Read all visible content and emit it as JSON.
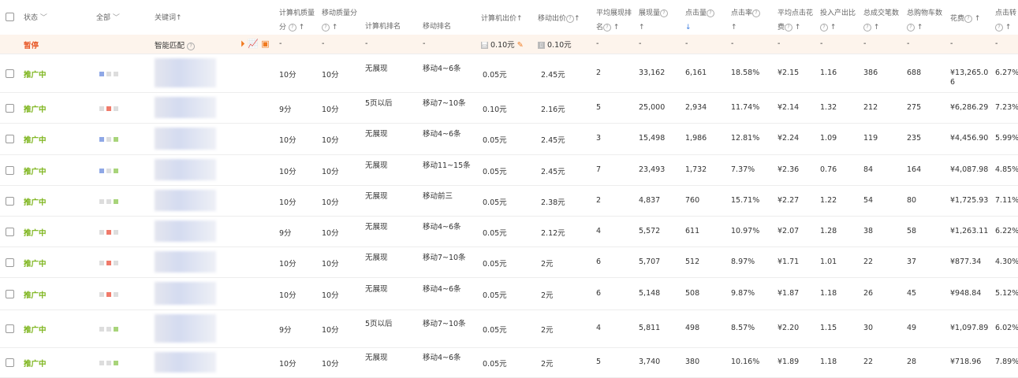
{
  "header": {
    "status": "状态",
    "all": "全部",
    "keyword": "关键词",
    "pc_quality_1": "计算机质量",
    "pc_quality_2": "分",
    "mobile_quality_1": "移动质量分",
    "pc_rank": "计算机排名",
    "mobile_rank": "移动排名",
    "pc_bid": "计算机出价",
    "mobile_bid": "移动出价",
    "avg_rank_1": "平均展现排",
    "avg_rank_2": "名",
    "impressions": "展现量",
    "clicks": "点击量",
    "ctr": "点击率",
    "avg_cpc_1": "平均点击花",
    "avg_cpc_2": "费",
    "roi": "投入产出比",
    "orders": "总成交笔数",
    "carts": "总购物车数",
    "cost": "花费",
    "conv": "点击转"
  },
  "paused_row": {
    "status": "暂停",
    "keyword": "智能匹配",
    "pc_bid": "0.10元",
    "mobile_bid": "0.10元",
    "dash": "-"
  },
  "rows": [
    {
      "status": "推广中",
      "sq": [
        "#8fa8e6",
        "#ddd",
        "#ddd"
      ],
      "pcq": "10分",
      "mq": "10分",
      "pcr": "无展现",
      "mr": "移动4~6条",
      "pcb": "0.05元",
      "mb": "2.45元",
      "avg": "2",
      "imp": "33,162",
      "clk": "6,161",
      "ctr": "18.58%",
      "cpc": "¥2.15",
      "roi": "1.16",
      "ord": "386",
      "cart": "688",
      "cost": "¥13,265.06",
      "conv": "6.27%"
    },
    {
      "status": "推广中",
      "sq": [
        "#ddd",
        "#f07a6a",
        "#ddd"
      ],
      "pcq": "9分",
      "mq": "10分",
      "pcr": "5页以后",
      "mr": "移动7~10条",
      "pcb": "0.10元",
      "mb": "2.16元",
      "avg": "5",
      "imp": "25,000",
      "clk": "2,934",
      "ctr": "11.74%",
      "cpc": "¥2.14",
      "roi": "1.32",
      "ord": "212",
      "cart": "275",
      "cost": "¥6,286.29",
      "conv": "7.23%"
    },
    {
      "status": "推广中",
      "sq": [
        "#8fa8e6",
        "#ddd",
        "#a8d47a"
      ],
      "pcq": "10分",
      "mq": "10分",
      "pcr": "无展现",
      "mr": "移动4~6条",
      "pcb": "0.05元",
      "mb": "2.45元",
      "avg": "3",
      "imp": "15,498",
      "clk": "1,986",
      "ctr": "12.81%",
      "cpc": "¥2.24",
      "roi": "1.09",
      "ord": "119",
      "cart": "235",
      "cost": "¥4,456.90",
      "conv": "5.99%"
    },
    {
      "status": "推广中",
      "sq": [
        "#8fa8e6",
        "#ddd",
        "#a8d47a"
      ],
      "pcq": "10分",
      "mq": "10分",
      "pcr": "无展现",
      "mr": "移动11~15条",
      "pcb": "0.05元",
      "mb": "2.45元",
      "avg": "7",
      "imp": "23,493",
      "clk": "1,732",
      "ctr": "7.37%",
      "cpc": "¥2.36",
      "roi": "0.76",
      "ord": "84",
      "cart": "164",
      "cost": "¥4,087.98",
      "conv": "4.85%"
    },
    {
      "status": "推广中",
      "sq": [
        "#ddd",
        "#ddd",
        "#a8d47a"
      ],
      "pcq": "10分",
      "mq": "10分",
      "pcr": "无展现",
      "mr": "移动前三",
      "pcb": "0.05元",
      "mb": "2.38元",
      "avg": "2",
      "imp": "4,837",
      "clk": "760",
      "ctr": "15.71%",
      "cpc": "¥2.27",
      "roi": "1.22",
      "ord": "54",
      "cart": "80",
      "cost": "¥1,725.93",
      "conv": "7.11%"
    },
    {
      "status": "推广中",
      "sq": [
        "#ddd",
        "#f07a6a",
        "#ddd"
      ],
      "pcq": "9分",
      "mq": "10分",
      "pcr": "无展现",
      "mr": "移动4~6条",
      "pcb": "0.05元",
      "mb": "2.12元",
      "avg": "4",
      "imp": "5,572",
      "clk": "611",
      "ctr": "10.97%",
      "cpc": "¥2.07",
      "roi": "1.28",
      "ord": "38",
      "cart": "58",
      "cost": "¥1,263.11",
      "conv": "6.22%"
    },
    {
      "status": "推广中",
      "sq": [
        "#ddd",
        "#f07a6a",
        "#ddd"
      ],
      "pcq": "10分",
      "mq": "10分",
      "pcr": "无展现",
      "mr": "移动7~10条",
      "pcb": "0.05元",
      "mb": "2元",
      "avg": "6",
      "imp": "5,707",
      "clk": "512",
      "ctr": "8.97%",
      "cpc": "¥1.71",
      "roi": "1.01",
      "ord": "22",
      "cart": "37",
      "cost": "¥877.34",
      "conv": "4.30%"
    },
    {
      "status": "推广中",
      "sq": [
        "#ddd",
        "#f07a6a",
        "#ddd"
      ],
      "pcq": "10分",
      "mq": "10分",
      "pcr": "无展现",
      "mr": "移动4~6条",
      "pcb": "0.05元",
      "mb": "2元",
      "avg": "6",
      "imp": "5,148",
      "clk": "508",
      "ctr": "9.87%",
      "cpc": "¥1.87",
      "roi": "1.18",
      "ord": "26",
      "cart": "45",
      "cost": "¥948.84",
      "conv": "5.12%"
    },
    {
      "status": "推广中",
      "sq": [
        "#ddd",
        "#ddd",
        "#a8d47a"
      ],
      "pcq": "9分",
      "mq": "10分",
      "pcr": "5页以后",
      "mr": "移动7~10条",
      "pcb": "0.05元",
      "mb": "2元",
      "avg": "4",
      "imp": "5,811",
      "clk": "498",
      "ctr": "8.57%",
      "cpc": "¥2.20",
      "roi": "1.15",
      "ord": "30",
      "cart": "49",
      "cost": "¥1,097.89",
      "conv": "6.02%"
    },
    {
      "status": "推广中",
      "sq": [
        "#ddd",
        "#ddd",
        "#a8d47a"
      ],
      "pcq": "10分",
      "mq": "10分",
      "pcr": "无展现",
      "mr": "移动4~6条",
      "pcb": "0.05元",
      "mb": "2元",
      "avg": "5",
      "imp": "3,740",
      "clk": "380",
      "ctr": "10.16%",
      "cpc": "¥1.89",
      "roi": "1.18",
      "ord": "22",
      "cart": "28",
      "cost": "¥718.96",
      "conv": "7.89%"
    }
  ]
}
